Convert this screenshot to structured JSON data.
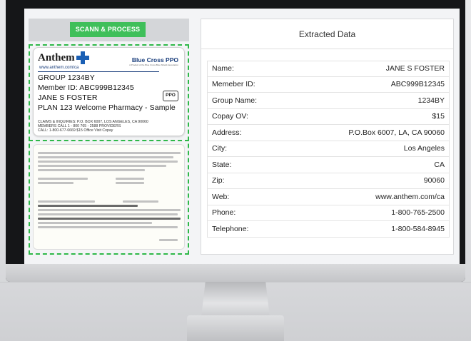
{
  "toolbar": {
    "scan_label": "SCANN & PROCESS"
  },
  "card_front": {
    "brand": "Anthem",
    "plan_brand": "Blue Cross PPO",
    "plan_brand_sub": "A Product of the Blue Cross Blue Shield Association",
    "url": "www.anthem.com/ca",
    "group": "GROUP 1234BY",
    "member": "Member ID: ABC999B12345",
    "name": "JANE S FOSTER",
    "plan": "PLAN 123 Welcome Pharmacy - Sample",
    "badge": "PPO",
    "claims1": "CLAIMS & INQUIRIES: P.O. BOX 6007, LOS ANGELES, CA 90060",
    "claims2": "MEMBERS CALL 1 - 800 765 - 2588 PROVIDERS",
    "claims3": "CALL: 1-800-677-6669 $15 Office Visit Copay"
  },
  "extracted": {
    "title": "Extracted Data",
    "rows": [
      {
        "label": "Name:",
        "value": "JANE S FOSTER"
      },
      {
        "label": "Memeber ID:",
        "value": "ABC999B12345"
      },
      {
        "label": "Group Name:",
        "value": "1234BY"
      },
      {
        "label": "Copay OV:",
        "value": "$15"
      },
      {
        "label": "Address:",
        "value": "P.O.Box 6007, LA, CA 90060"
      },
      {
        "label": "City:",
        "value": "Los Angeles"
      },
      {
        "label": "State:",
        "value": "CA"
      },
      {
        "label": "Zip:",
        "value": "90060"
      },
      {
        "label": "Web:",
        "value": "www.anthem.com/ca"
      },
      {
        "label": "Phone:",
        "value": "1-800-765-2500"
      },
      {
        "label": "Telephone:",
        "value": "1-800-584-8945"
      }
    ]
  },
  "colors": {
    "accent": "#3fbf5a",
    "dash": "#2eb848",
    "brand_blue": "#1a5fb4"
  }
}
